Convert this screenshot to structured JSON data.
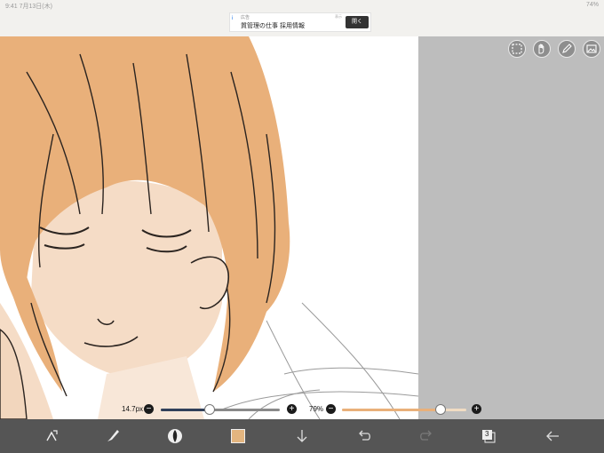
{
  "status": {
    "left": "9:41  7月13日(木)",
    "right": "74%"
  },
  "ad": {
    "info_mark": "i",
    "small_text": "広告",
    "title": "質管理の仕事 採用情報",
    "sponsor": "表示",
    "open_label": "開く"
  },
  "tools": [
    {
      "name": "selection-tool",
      "icon": "dashed-square-icon"
    },
    {
      "name": "hand-tool",
      "icon": "hand-icon"
    },
    {
      "name": "pencil-tool",
      "icon": "pencil-icon"
    },
    {
      "name": "image-tool",
      "icon": "image-icon"
    }
  ],
  "brush": {
    "size_label": "14.7px",
    "size_level": 0.41,
    "opacity_label": "79%",
    "opacity_level": 0.79
  },
  "colors": {
    "current": "#e3b57f",
    "hair": "#e9b07a",
    "skin": "#f5dcc6",
    "accent_slider": "#31405a",
    "opacity_slider": "#e9b07a"
  },
  "bottom": {
    "layer_count": "3"
  }
}
